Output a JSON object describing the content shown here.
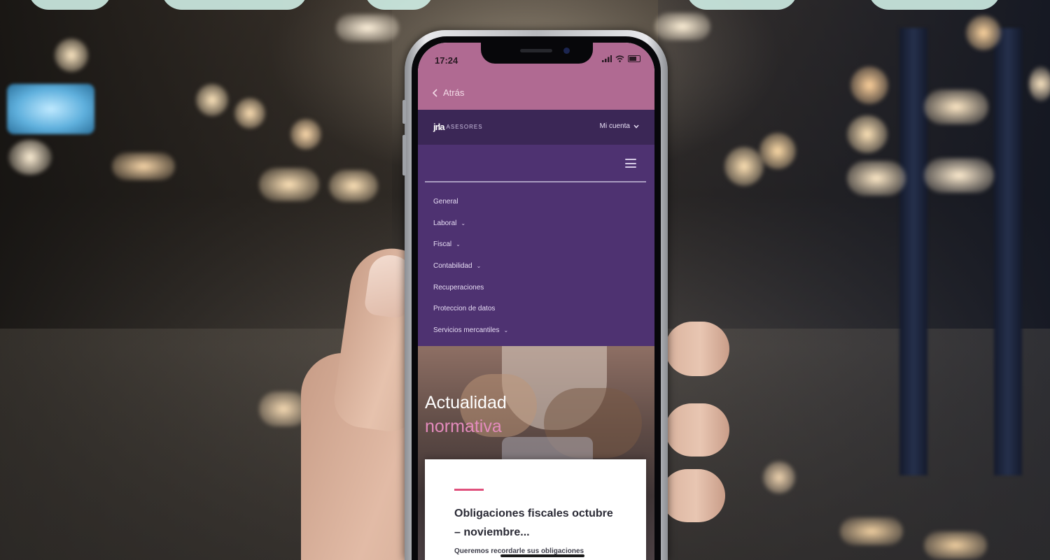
{
  "status_bar": {
    "time": "17:24"
  },
  "nav_bar": {
    "back_label": "Atrás"
  },
  "site_header": {
    "logo_mark": "jrla",
    "logo_text": "ASESORES",
    "account_label": "Mi cuenta"
  },
  "menu": {
    "items": [
      {
        "label": "General",
        "has_submenu": false
      },
      {
        "label": "Laboral",
        "has_submenu": true
      },
      {
        "label": "Fiscal",
        "has_submenu": true
      },
      {
        "label": "Contabilidad",
        "has_submenu": true
      },
      {
        "label": "Recuperaciones",
        "has_submenu": false
      },
      {
        "label": "Proteccion de datos",
        "has_submenu": false
      },
      {
        "label": "Servicios mercantiles",
        "has_submenu": true
      }
    ]
  },
  "hero": {
    "title_line1": "Actualidad",
    "title_line2": "normativa"
  },
  "article_card": {
    "title": "Obligaciones fiscales octubre – noviembre...",
    "excerpt": "Queremos recordarle sus obligaciones"
  },
  "colors": {
    "status_bar": "#b06a92",
    "site_header": "#3b2756",
    "menu_background": "#4e3271",
    "accent_pink": "#e48bbd",
    "card_accent": "#e0507c"
  },
  "icons": [
    "back-chevron-icon",
    "signal-icon",
    "wifi-icon",
    "battery-icon",
    "account-chevron-icon",
    "hamburger-menu-icon",
    "submenu-chevron-icon"
  ]
}
